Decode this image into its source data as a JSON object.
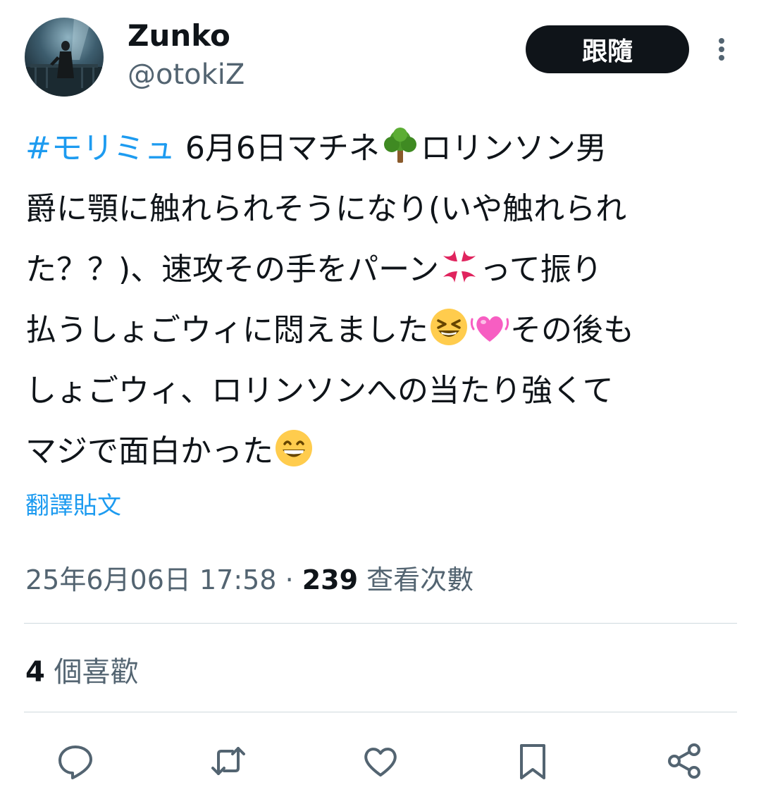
{
  "author": {
    "display_name": "Zunko",
    "handle": "@otokiZ"
  },
  "header": {
    "follow_label": "跟隨"
  },
  "tweet": {
    "hashtag": "#モリミュ",
    "line1_rest": " 6月6日マチネ",
    "line1_after_emoji": "ロリンソン男",
    "line2": "爵に顎に触れられそうになり(いや触れられ",
    "line3_before_emoji": "た？？)、速攻その手をパーン",
    "line3_after_emoji": "って振り",
    "line4_before_emoji": "払うしょごウィに悶えました",
    "line4_after_emoji": "その後も",
    "line5": "しょごウィ、ロリンソンへの当たり強くて",
    "line6": "マジで面白かった",
    "emojis": [
      "tree-emoji",
      "anger-emoji",
      "laughing-emoji",
      "beating-heart-emoji",
      "grinning-emoji"
    ]
  },
  "translate_label": "翻譯貼文",
  "meta": {
    "timestamp": "25年6月06日 17:58",
    "separator": " · ",
    "views_count": "239",
    "views_label": " 查看次數"
  },
  "likes": {
    "count": "4",
    "label": " 個喜歡"
  },
  "actions": [
    "reply-icon",
    "retweet-icon",
    "like-icon",
    "bookmark-icon",
    "share-icon"
  ],
  "colors": {
    "link": "#1d9bf0",
    "text": "#0f1419",
    "secondary": "#536471",
    "divider": "#cfd9de"
  }
}
